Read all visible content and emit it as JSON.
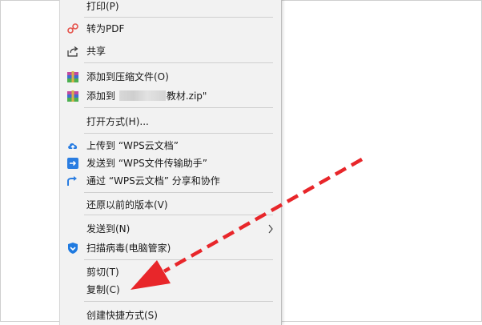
{
  "menu": {
    "print": "打印(P)",
    "to_pdf": "转为PDF",
    "share": "共享",
    "add_archive": "添加到压缩文件(O)",
    "add_to_prefix": "添加到",
    "add_to_suffix": "教材.zip\"",
    "open_with": "打开方式(H)...",
    "upload_wps": "上传到 “WPS云文档”",
    "send_wps_helper": "发送到 “WPS文件传输助手”",
    "share_wps": "通过 “WPS云文档” 分享和协作",
    "restore": "还原以前的版本(V)",
    "send_to": "发送到(N)",
    "scan_virus": "扫描病毒(电脑管家)",
    "cut": "剪切(T)",
    "copy": "复制(C)",
    "create_shortcut": "创建快捷方式(S)"
  },
  "annotation": {
    "arrow_color": "#e8262a",
    "points_to": "copy"
  },
  "colors": {
    "pdf_icon": "#e5534b",
    "cloud_icon": "#2a7de1",
    "shield_icon": "#1f7ae0"
  }
}
